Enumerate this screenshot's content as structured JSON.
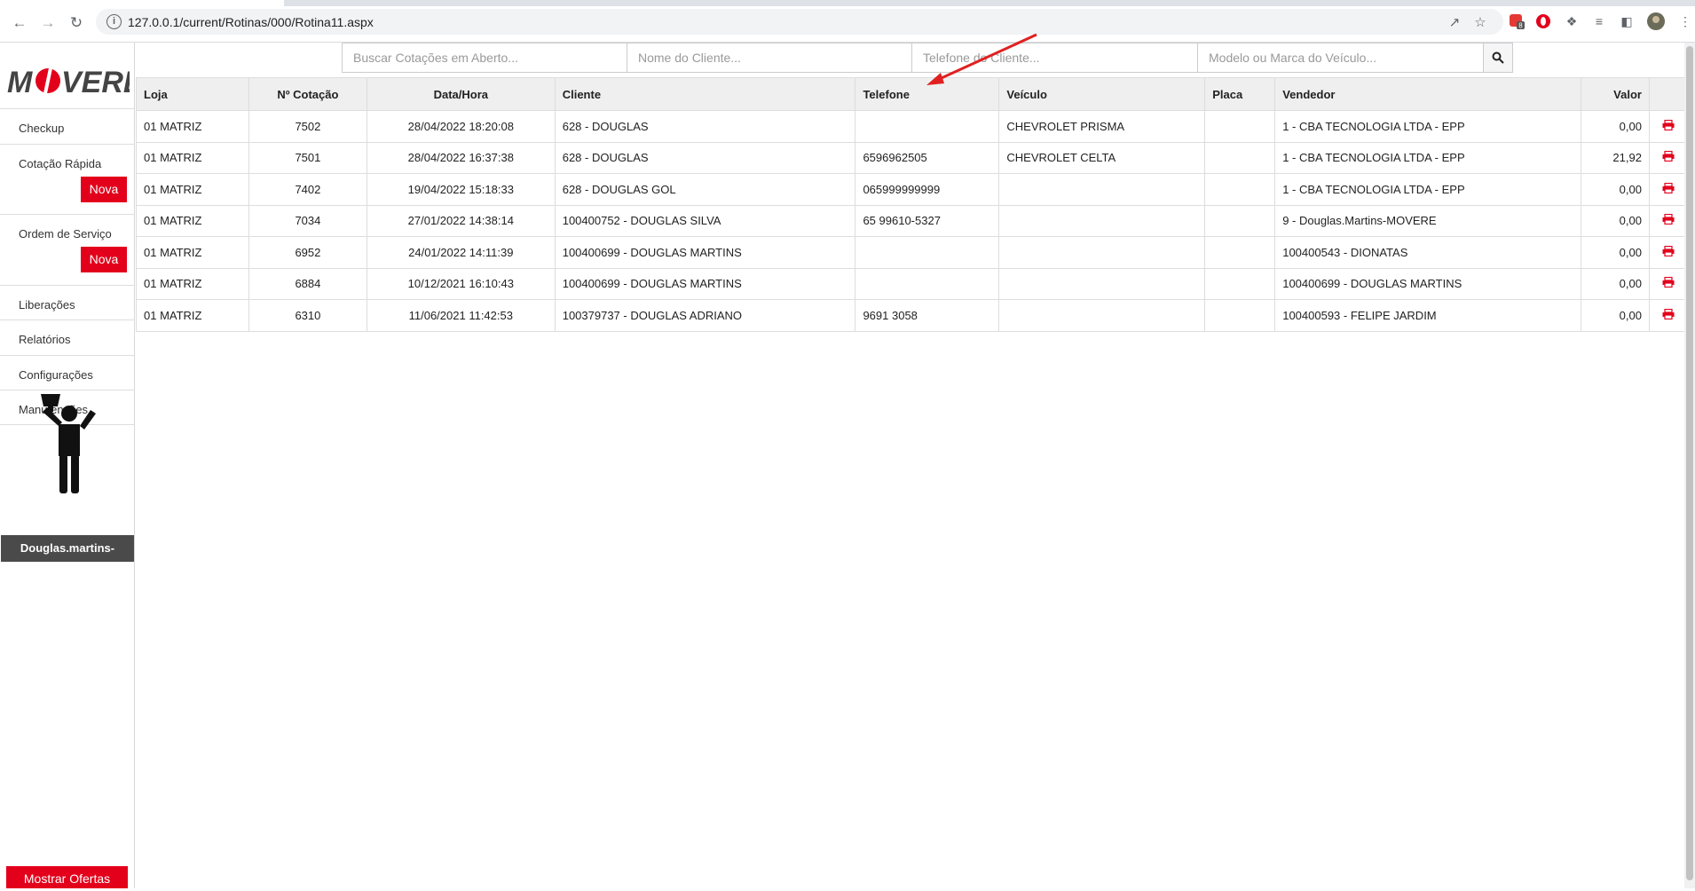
{
  "browser": {
    "url": "127.0.0.1/current/Rotinas/000/Rotina11.aspx",
    "ext_badge": "8"
  },
  "sidebar": {
    "logo_text_left": "M",
    "logo_text_right": "VERE",
    "items": [
      {
        "label": "Checkup"
      },
      {
        "label": "Cotação Rápida",
        "action": "Nova"
      },
      {
        "label": "Ordem de Serviço",
        "action": "Nova"
      },
      {
        "label": "Liberações"
      },
      {
        "label": "Relatórios"
      },
      {
        "label": "Configurações"
      },
      {
        "label": "Manutenções"
      }
    ],
    "user": "Douglas.martins-",
    "ofertas_label": "Mostrar Ofertas"
  },
  "search": {
    "cotacoes_placeholder": "Buscar Cotações em Aberto...",
    "cliente_placeholder": "Nome do Cliente...",
    "telefone_placeholder": "Telefone do Cliente...",
    "veiculo_placeholder": "Modelo ou Marca do Veículo..."
  },
  "table": {
    "headers": [
      "Loja",
      "Nº Cotação",
      "Data/Hora",
      "Cliente",
      "Telefone",
      "Veículo",
      "Placa",
      "Vendedor",
      "Valor"
    ],
    "rows": [
      [
        "01 MATRIZ",
        "7502",
        "28/04/2022 18:20:08",
        "628 - DOUGLAS",
        "",
        "CHEVROLET PRISMA",
        "",
        "1 - CBA TECNOLOGIA LTDA - EPP",
        "0,00"
      ],
      [
        "01 MATRIZ",
        "7501",
        "28/04/2022 16:37:38",
        "628 - DOUGLAS",
        "6596962505",
        "CHEVROLET CELTA",
        "",
        "1 - CBA TECNOLOGIA LTDA - EPP",
        "21,92"
      ],
      [
        "01 MATRIZ",
        "7402",
        "19/04/2022 15:18:33",
        "628 - DOUGLAS GOL",
        "065999999999",
        "",
        "",
        "1 - CBA TECNOLOGIA LTDA - EPP",
        "0,00"
      ],
      [
        "01 MATRIZ",
        "7034",
        "27/01/2022 14:38:14",
        "100400752 - DOUGLAS SILVA",
        "65 99610-5327",
        "",
        "",
        "9 - Douglas.Martins-MOVERE",
        "0,00"
      ],
      [
        "01 MATRIZ",
        "6952",
        "24/01/2022 14:11:39",
        "100400699 - DOUGLAS MARTINS",
        "",
        "",
        "",
        "100400543 - DIONATAS",
        "0,00"
      ],
      [
        "01 MATRIZ",
        "6884",
        "10/12/2021 16:10:43",
        "100400699 - DOUGLAS MARTINS",
        "",
        "",
        "",
        "100400699 - DOUGLAS MARTINS",
        "0,00"
      ],
      [
        "01 MATRIZ",
        "6310",
        "11/06/2021 11:42:53",
        "100379737 - DOUGLAS ADRIANO",
        "9691 3058",
        "",
        "",
        "100400593 - FELIPE JARDIM",
        "0,00"
      ]
    ]
  },
  "colors": {
    "accent": "#e3001b",
    "user_bar": "#4a4a4a"
  }
}
